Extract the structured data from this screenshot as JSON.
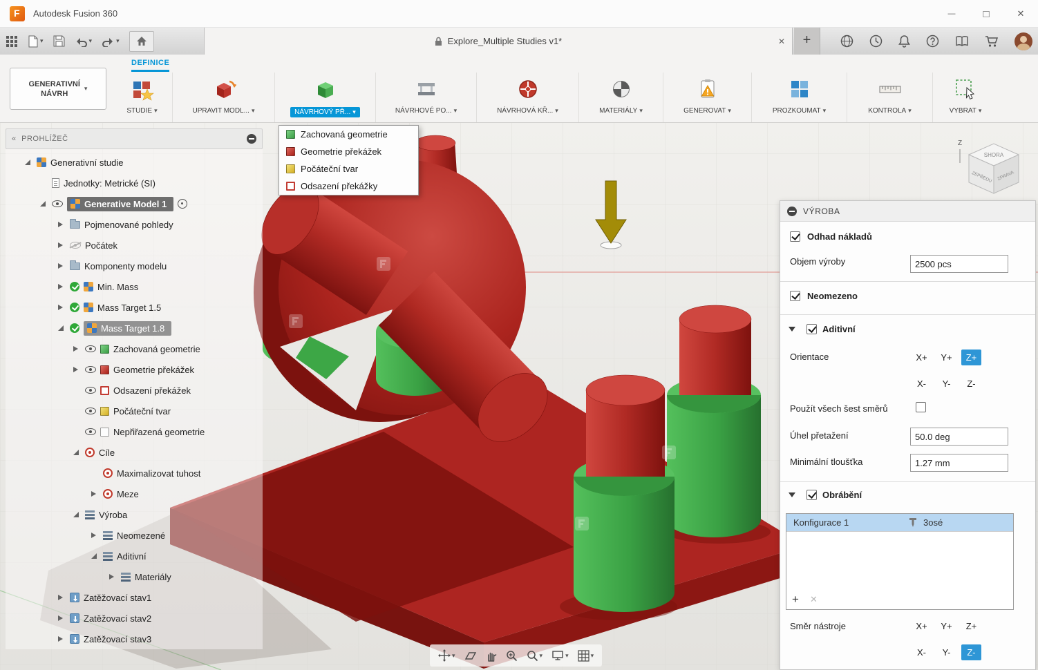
{
  "window": {
    "title": "Autodesk Fusion 360"
  },
  "tabbar": {
    "document_tab": "Explore_Multiple Studies v1*"
  },
  "ribbon": {
    "tab": "DEFINICE",
    "context": {
      "line1": "GENERATIVNÍ",
      "line2": "NÁVRH"
    },
    "groups": [
      {
        "label": "STUDIE"
      },
      {
        "label": "UPRAVIT MODL..."
      },
      {
        "label": "NÁVRHOVÝ PŘ..."
      },
      {
        "label": "NÁVRHOVÉ PO..."
      },
      {
        "label": "NÁVRHOVÁ KŘ..."
      },
      {
        "label": "MATERIÁLY"
      },
      {
        "label": "GENEROVAT"
      },
      {
        "label": "PROZKOUMAT"
      },
      {
        "label": "KONTROLA"
      },
      {
        "label": "VYBRAT"
      }
    ]
  },
  "menu": {
    "items": [
      {
        "label": "Zachovaná geometrie",
        "icon": "cube-green"
      },
      {
        "label": "Geometrie překážek",
        "icon": "cube-red"
      },
      {
        "label": "Počáteční tvar",
        "icon": "cube-yellow"
      },
      {
        "label": "Odsazení překážky",
        "icon": "cube-red-outline"
      }
    ]
  },
  "browser": {
    "title": "PROHLÍŽEČ",
    "items": [
      {
        "label": "Generativní studie"
      },
      {
        "label": "Jednotky: Metrické (SI)"
      },
      {
        "label": "Generative Model 1"
      },
      {
        "label": "Pojmenované pohledy"
      },
      {
        "label": "Počátek"
      },
      {
        "label": "Komponenty modelu"
      },
      {
        "label": "Min. Mass"
      },
      {
        "label": "Mass Target 1.5"
      },
      {
        "label": "Mass Target 1.8"
      },
      {
        "label": "Zachovaná geometrie"
      },
      {
        "label": "Geometrie překážek"
      },
      {
        "label": "Odsazení překážek"
      },
      {
        "label": "Počáteční tvar"
      },
      {
        "label": "Nepřiřazená geometrie"
      },
      {
        "label": "Cíle"
      },
      {
        "label": "Maximalizovat tuhost"
      },
      {
        "label": "Meze"
      },
      {
        "label": "Výroba"
      },
      {
        "label": "Neomezené"
      },
      {
        "label": "Aditivní"
      },
      {
        "label": "Materiály"
      },
      {
        "label": "Zatěžovací stav1"
      },
      {
        "label": "Zatěžovací stav2"
      },
      {
        "label": "Zatěžovací stav3"
      }
    ]
  },
  "panel": {
    "title": "VÝROBA",
    "cost_label": "Odhad nákladů",
    "volume_label": "Objem výroby",
    "volume_value": "2500 pcs",
    "unlimited_label": "Neomezeno",
    "additive": {
      "title": "Aditivní",
      "orientation_label": "Orientace",
      "six_label": "Použít všech šest směrů",
      "overhang_label": "Úhel přetažení",
      "overhang_value": "50.0 deg",
      "thickness_label": "Minimální tloušťka",
      "thickness_value": "1.27 mm"
    },
    "machining": {
      "title": "Obrábění",
      "config": "Konfigurace 1",
      "type": "3osé",
      "tooldir_label": "Směr nástroje",
      "add": "+",
      "remove": "✕"
    },
    "axes": {
      "xp": "X+",
      "yp": "Y+",
      "zp": "Z+",
      "xn": "X-",
      "yn": "Y-",
      "zn": "Z-"
    }
  },
  "viewcube": {
    "top": "SHORA",
    "front": "ZEPŘEDU",
    "right": "ZPRAVA",
    "axis": "Z"
  },
  "colors": {
    "accent": "#0696d7",
    "selection_blue": "#2e96d6",
    "model_red": "#b32622",
    "model_green": "#3fae49",
    "arrow_yellow": "#a38c08"
  }
}
